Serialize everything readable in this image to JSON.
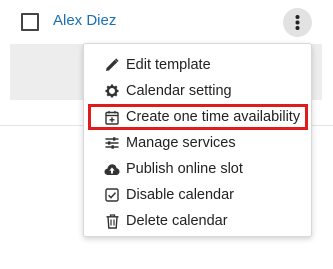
{
  "row": {
    "name": "Alex Diez"
  },
  "menu": {
    "items": [
      {
        "label": "Edit template",
        "icon": "pencil-icon"
      },
      {
        "label": "Calendar setting",
        "icon": "gear-icon"
      },
      {
        "label": "Create one time availability",
        "icon": "calendar-plus-icon",
        "highlighted": true
      },
      {
        "label": "Manage services",
        "icon": "sliders-icon"
      },
      {
        "label": "Publish online slot",
        "icon": "cloud-upload-icon"
      },
      {
        "label": "Disable calendar",
        "icon": "checkbox-icon"
      },
      {
        "label": "Delete calendar",
        "icon": "trash-icon"
      }
    ]
  },
  "colors": {
    "link": "#1a6fb3",
    "highlight_border": "#e01b1b"
  }
}
